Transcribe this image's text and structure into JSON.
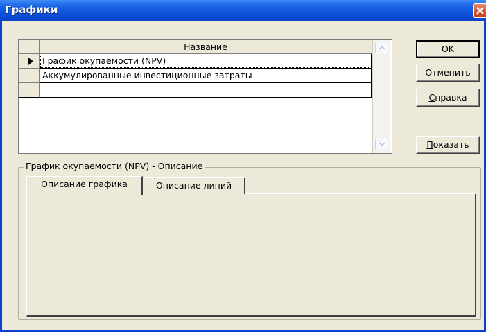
{
  "window": {
    "title": "Графики"
  },
  "grid": {
    "column_header": "Название",
    "rows": [
      {
        "name": "График окупаемости (NPV)",
        "selected": true
      },
      {
        "name": "Аккумулированные инвестиционные затраты",
        "selected": false
      },
      {
        "name": "",
        "selected": false
      }
    ]
  },
  "buttons": {
    "ok": "OK",
    "cancel": "Отменить",
    "help_prefix": "",
    "help_underlined": "С",
    "help_rest": "правка",
    "show_prefix": "",
    "show_underlined": "П",
    "show_rest": "оказать"
  },
  "description": {
    "group_title": "График окупаемости (NPV) - Описание",
    "tabs": [
      {
        "label": "Описание графика",
        "active": true
      },
      {
        "label": "Описание линий",
        "active": false
      }
    ]
  },
  "icons": {
    "close": "close-icon",
    "row_pointer": "row-pointer-icon",
    "scroll_up": "scroll-up-icon",
    "scroll_down": "scroll-down-icon"
  }
}
